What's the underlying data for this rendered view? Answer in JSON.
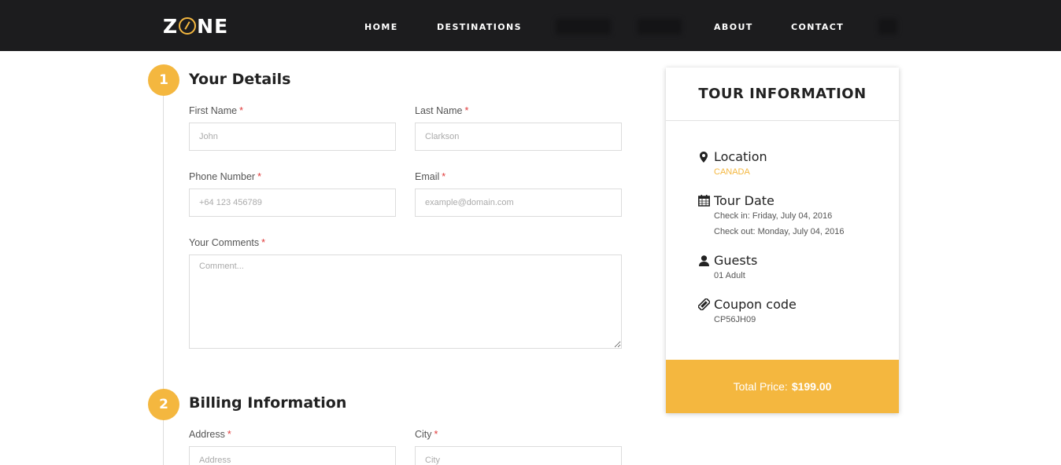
{
  "brand": {
    "logo_text_left": "Z",
    "logo_text_right": "NE"
  },
  "nav": {
    "items": [
      {
        "label": "HOME"
      },
      {
        "label": "DESTINATIONS"
      },
      {
        "label": "ABOUT"
      },
      {
        "label": "CONTACT"
      }
    ]
  },
  "steps": [
    {
      "number": "1",
      "title": "Your Details"
    },
    {
      "number": "2",
      "title": "Billing Information"
    }
  ],
  "details": {
    "first_name": {
      "label": "First Name",
      "required": "*",
      "placeholder": "John"
    },
    "last_name": {
      "label": "Last Name",
      "required": "*",
      "placeholder": "Clarkson"
    },
    "phone": {
      "label": "Phone Number",
      "required": "*",
      "placeholder": "+64 123 456789"
    },
    "email": {
      "label": "Email",
      "required": "*",
      "placeholder": "example@domain.com"
    },
    "comments": {
      "label": "Your Comments",
      "required": "*",
      "placeholder": "Comment..."
    }
  },
  "billing": {
    "address": {
      "label": "Address",
      "required": "*",
      "placeholder": "Address"
    },
    "city": {
      "label": "City",
      "required": "*",
      "placeholder": "City"
    }
  },
  "tour": {
    "heading": "TOUR INFORMATION",
    "location": {
      "title": "Location",
      "value": "CANADA",
      "icon": "map-marker-icon"
    },
    "tour_date": {
      "title": "Tour Date",
      "check_in": "Check in: Friday, July 04, 2016",
      "check_out": "Check out: Monday, July 04, 2016",
      "icon": "calendar-icon"
    },
    "guests": {
      "title": "Guests",
      "value": "01 Adult",
      "icon": "user-icon"
    },
    "coupon": {
      "title": "Coupon code",
      "value": "CP56JH09",
      "icon": "ticket-icon"
    },
    "total_label": "Total Price:",
    "total_value": "$199.00"
  },
  "colors": {
    "accent": "#f4b73f",
    "navbar": "#1c1c1e",
    "required": "#e03b3b"
  }
}
